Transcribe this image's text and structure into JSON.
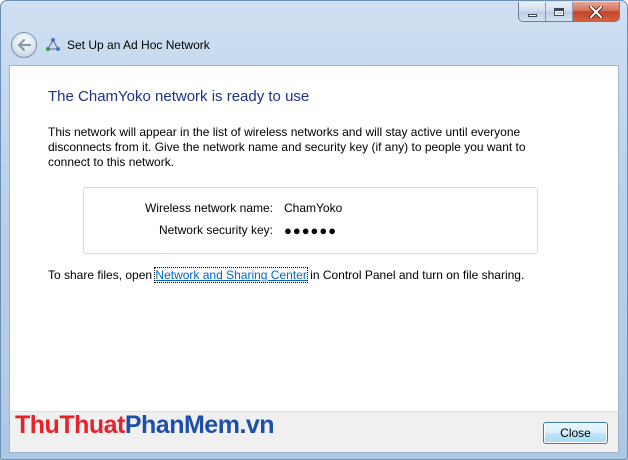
{
  "window": {
    "caption_buttons": [
      "minimize",
      "maximize",
      "close"
    ]
  },
  "header": {
    "title": "Set Up an Ad Hoc Network",
    "back_icon": "back-arrow-icon",
    "wizard_icon": "adhoc-network-icon"
  },
  "main": {
    "heading": "The ChamYoko network is ready to use",
    "description": "This network will appear in the list of wireless networks and will stay active until everyone disconnects from it. Give the network name and security key (if any) to people you want to connect to this network.",
    "network_name_label": "Wireless network name:",
    "network_name_value": "ChamYoko",
    "security_key_label": "Network security key:",
    "security_key_value": "●●●●●●",
    "share_prefix": "To share files, open ",
    "share_link": "Network and Sharing Center",
    "share_suffix": " in Control Panel and turn on file sharing."
  },
  "footer": {
    "close_label": "Close"
  },
  "watermark": {
    "part1": "ThuThuat",
    "part2": "PhanMem",
    "part3": ".vn",
    "colors": {
      "red": "#e8222a",
      "blue": "#1e4fa8"
    }
  },
  "colors": {
    "heading": "#1e3287",
    "link": "#0066cc",
    "close_caption": "#c2452a"
  }
}
